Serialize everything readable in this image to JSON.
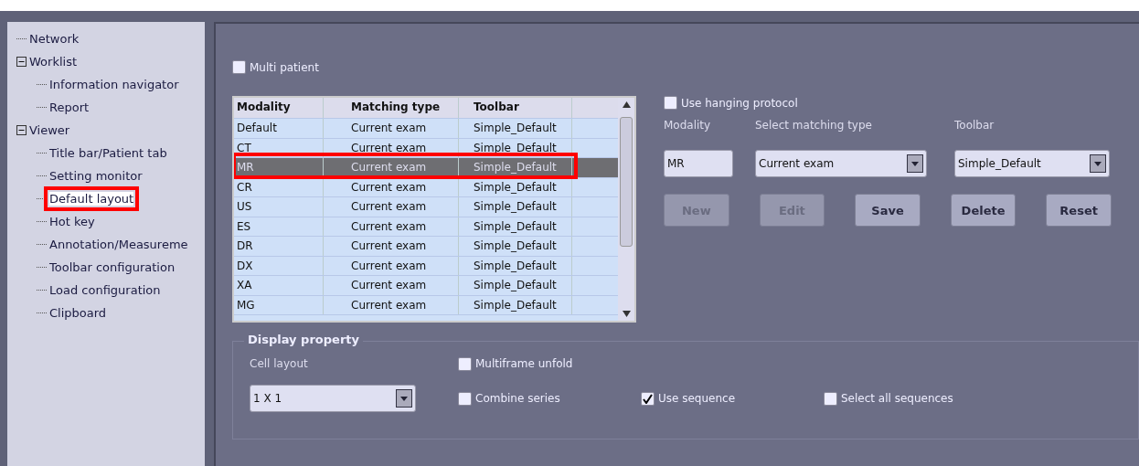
{
  "tree": [
    {
      "label": "Network",
      "selected": false
    },
    {
      "label": "Worklist",
      "expanded": true,
      "selected": false,
      "children": [
        {
          "label": "Information navigator",
          "selected": false
        },
        {
          "label": "Report",
          "selected": false
        }
      ]
    },
    {
      "label": "Viewer",
      "expanded": true,
      "selected": false,
      "children": [
        {
          "label": "Title bar/Patient tab",
          "selected": false
        },
        {
          "label": "Setting monitor",
          "selected": false
        },
        {
          "label": "Default layout",
          "selected": true
        },
        {
          "label": "Hot key",
          "selected": false
        },
        {
          "label": "Annotation/Measureme",
          "selected": false
        },
        {
          "label": "Toolbar configuration",
          "selected": false
        },
        {
          "label": "Load configuration",
          "selected": false
        },
        {
          "label": "Clipboard",
          "selected": false
        }
      ]
    }
  ],
  "multi_patient": {
    "label": "Multi patient",
    "checked": false
  },
  "table": {
    "columns": [
      "Modality",
      "Matching type",
      "Toolbar"
    ],
    "rows": [
      {
        "cells": [
          "Default",
          "Current exam",
          "Simple_Default"
        ],
        "selected": false
      },
      {
        "cells": [
          "CT",
          "Current exam",
          "Simple_Default"
        ],
        "selected": false
      },
      {
        "cells": [
          "MR",
          "Current exam",
          "Simple_Default"
        ],
        "selected": true
      },
      {
        "cells": [
          "CR",
          "Current exam",
          "Simple_Default"
        ],
        "selected": false
      },
      {
        "cells": [
          "US",
          "Current exam",
          "Simple_Default"
        ],
        "selected": false
      },
      {
        "cells": [
          "ES",
          "Current exam",
          "Simple_Default"
        ],
        "selected": false
      },
      {
        "cells": [
          "DR",
          "Current exam",
          "Simple_Default"
        ],
        "selected": false
      },
      {
        "cells": [
          "DX",
          "Current exam",
          "Simple_Default"
        ],
        "selected": false
      },
      {
        "cells": [
          "XA",
          "Current exam",
          "Simple_Default"
        ],
        "selected": false
      },
      {
        "cells": [
          "MG",
          "Current exam",
          "Simple_Default"
        ],
        "selected": false
      }
    ]
  },
  "hanging_protocol": {
    "label": "Use hanging protocol",
    "checked": false
  },
  "editor": {
    "modality_label": "Modality",
    "modality_value": "MR",
    "matching_label": "Select matching type",
    "matching_value": "Current exam",
    "toolbar_label": "Toolbar",
    "toolbar_value": "Simple_Default"
  },
  "buttons": [
    {
      "label": "New",
      "disabled": true
    },
    {
      "label": "Edit",
      "disabled": true
    },
    {
      "label": "Save",
      "disabled": false
    },
    {
      "label": "Delete",
      "disabled": false
    },
    {
      "label": "Reset",
      "disabled": false
    }
  ],
  "display_property": {
    "title": "Display property",
    "cell_layout_label": "Cell layout",
    "cell_layout_value": "1 X 1",
    "options": [
      {
        "label": "Multiframe unfold",
        "checked": false
      },
      {
        "label": "Combine series",
        "checked": false
      },
      {
        "label": "Use sequence",
        "checked": true
      },
      {
        "label": "Select all sequences",
        "checked": false
      }
    ]
  }
}
